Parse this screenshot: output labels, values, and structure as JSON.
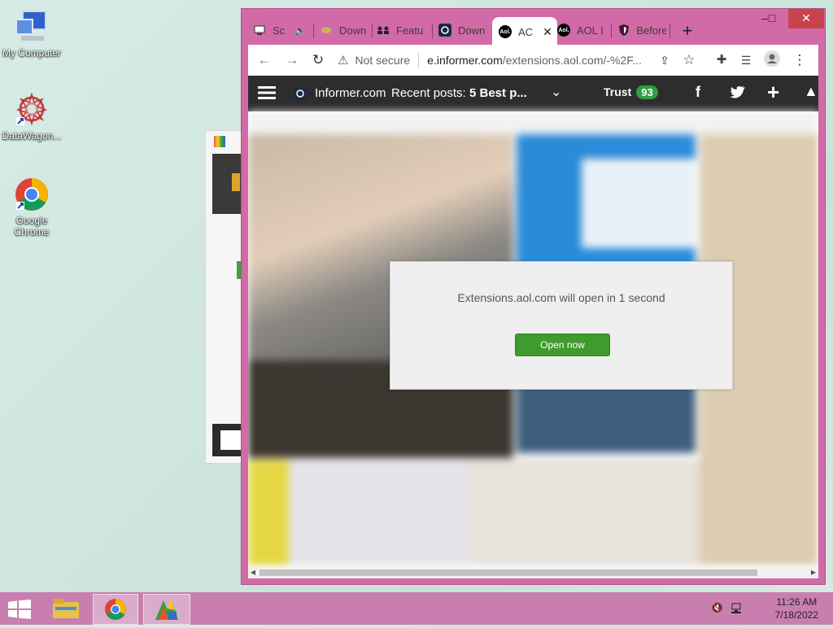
{
  "desktop": {
    "icons": [
      {
        "label": "My Computer",
        "icon": "computer-icon"
      },
      {
        "label": "DataWagon...",
        "icon": "datawagon-icon"
      },
      {
        "label": "Google Chrome",
        "icon": "chrome-icon"
      }
    ]
  },
  "browser": {
    "tabs": [
      {
        "title": "Sc",
        "icon": "monitor-icon"
      },
      {
        "title": "Down",
        "icon": "download-icon"
      },
      {
        "title": "Featu",
        "icon": "group-icon"
      },
      {
        "title": "Down",
        "icon": "search-logo-icon"
      },
      {
        "title": "AC",
        "icon": "aol-icon",
        "active": true
      },
      {
        "title": "AOL I",
        "icon": "aol-icon"
      },
      {
        "title": "Before",
        "icon": "shield-icon"
      }
    ],
    "new_tab": "+",
    "window_controls": {
      "minimize": "–",
      "maximize": "□",
      "close": "✕"
    },
    "address": {
      "security": "Not secure",
      "url_host": "e.informer.com",
      "url_path": "/extensions.aol.com/-%2F..."
    }
  },
  "site": {
    "brand": "Informer.com",
    "recent_label": "Recent posts:",
    "recent_title": "5 Best p...",
    "trust_label": "Trust",
    "trust_score": "93"
  },
  "modal": {
    "message": "Extensions.aol.com will open in 1 second",
    "button": "Open now"
  },
  "taskbar": {
    "time": "11:26 AM",
    "date": "7/18/2022"
  },
  "colors": {
    "chrome_frame": "#d26aa8",
    "taskbar": "#c87fb0",
    "open_button": "#3f9b2e",
    "trust_badge": "#2e9e43"
  }
}
